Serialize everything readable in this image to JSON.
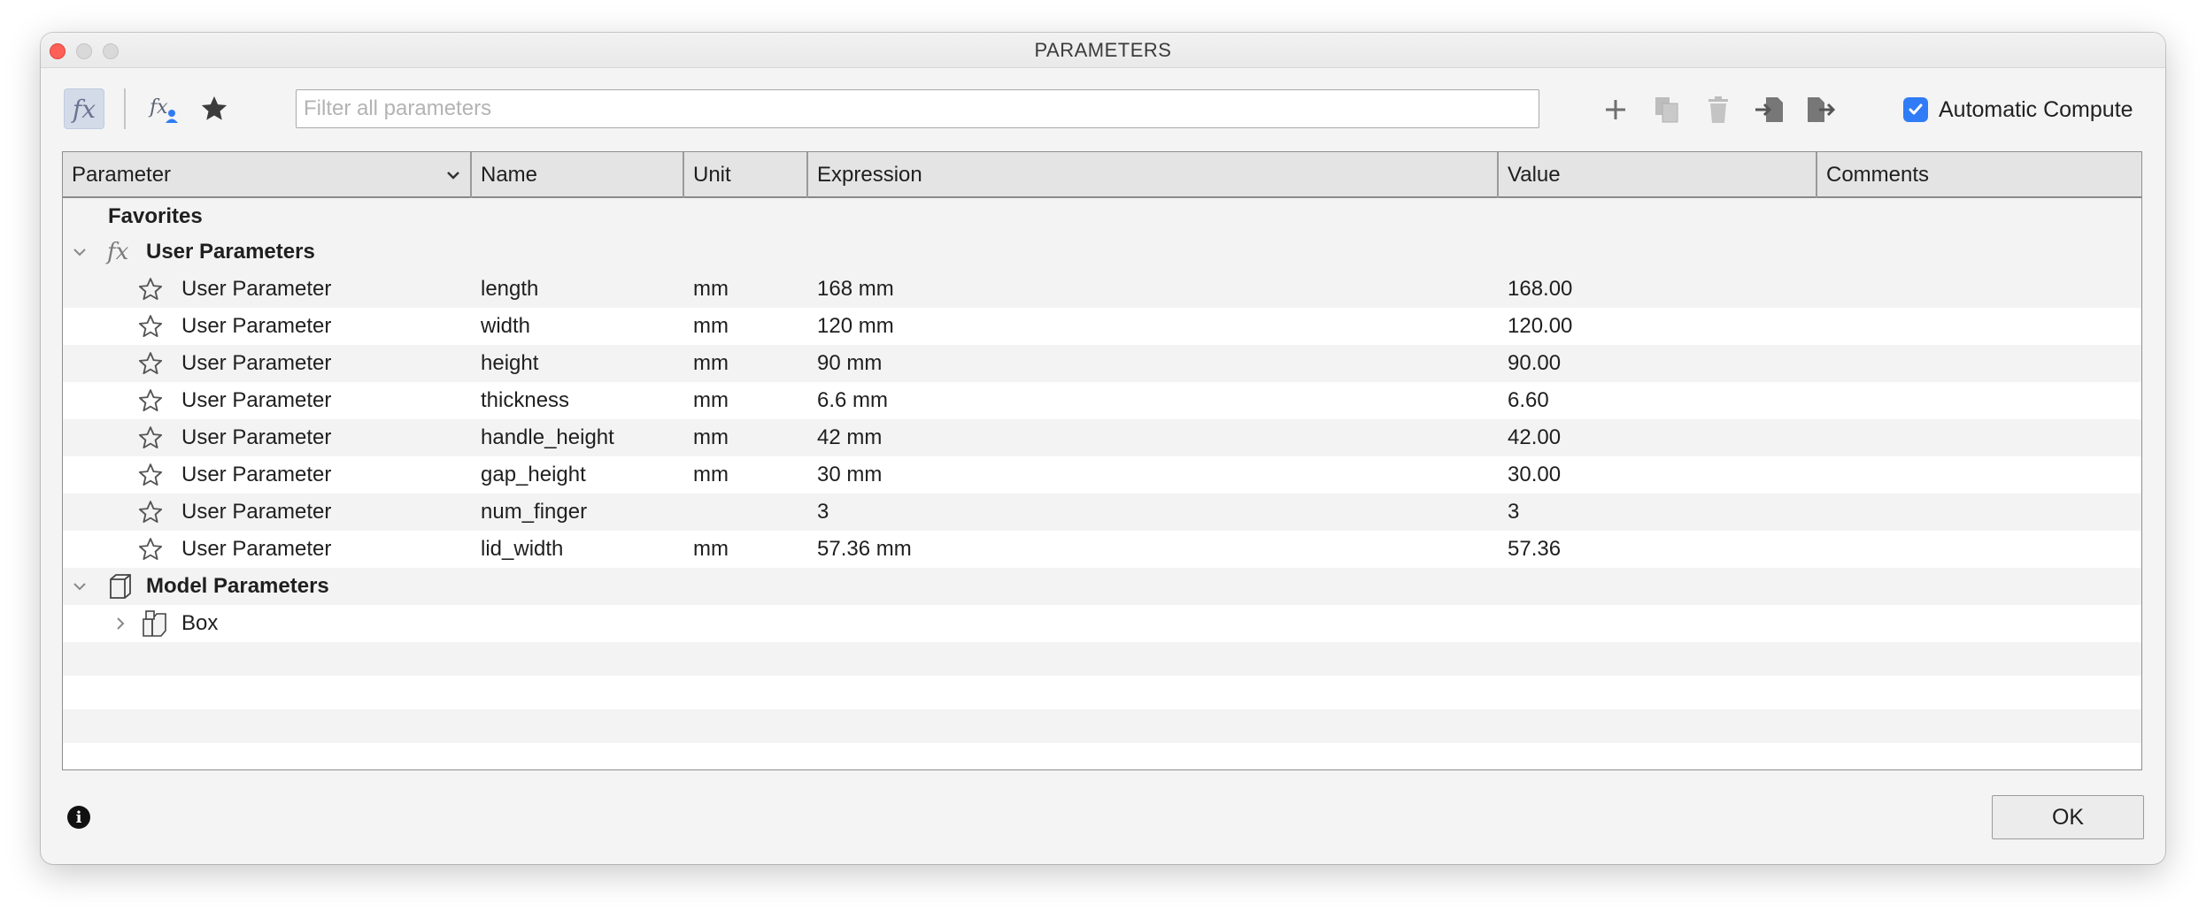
{
  "window": {
    "title": "PARAMETERS"
  },
  "toolbar": {
    "filter_placeholder": "Filter all parameters",
    "icons": [
      "fx-all-parameters-icon",
      "fx-user-parameters-icon",
      "star-favorites-icon",
      "add-icon",
      "copy-icon",
      "delete-icon",
      "import-icon",
      "export-icon"
    ],
    "automatic_compute": {
      "label": "Automatic Compute",
      "checked": true
    }
  },
  "table": {
    "headers": [
      "Parameter",
      "Name",
      "Unit",
      "Expression",
      "Value",
      "Comments"
    ],
    "groups": {
      "favorites": "Favorites",
      "user_parameters": "User Parameters",
      "model_parameters": "Model Parameters"
    },
    "user_rows": [
      {
        "parameter": "User Parameter",
        "name": "length",
        "unit": "mm",
        "expression": "168 mm",
        "value": "168.00",
        "comments": ""
      },
      {
        "parameter": "User Parameter",
        "name": "width",
        "unit": "mm",
        "expression": "120 mm",
        "value": "120.00",
        "comments": ""
      },
      {
        "parameter": "User Parameter",
        "name": "height",
        "unit": "mm",
        "expression": "90 mm",
        "value": "90.00",
        "comments": ""
      },
      {
        "parameter": "User Parameter",
        "name": "thickness",
        "unit": "mm",
        "expression": "6.6 mm",
        "value": "6.60",
        "comments": ""
      },
      {
        "parameter": "User Parameter",
        "name": "handle_height",
        "unit": "mm",
        "expression": "42 mm",
        "value": "42.00",
        "comments": ""
      },
      {
        "parameter": "User Parameter",
        "name": "gap_height",
        "unit": "mm",
        "expression": "30 mm",
        "value": "30.00",
        "comments": ""
      },
      {
        "parameter": "User Parameter",
        "name": "num_finger",
        "unit": "",
        "expression": "3",
        "value": "3",
        "comments": ""
      },
      {
        "parameter": "User Parameter",
        "name": "lid_width",
        "unit": "mm",
        "expression": "57.36 mm",
        "value": "57.36",
        "comments": ""
      }
    ],
    "model_children": [
      {
        "label": "Box"
      }
    ]
  },
  "footer": {
    "ok_label": "OK"
  }
}
